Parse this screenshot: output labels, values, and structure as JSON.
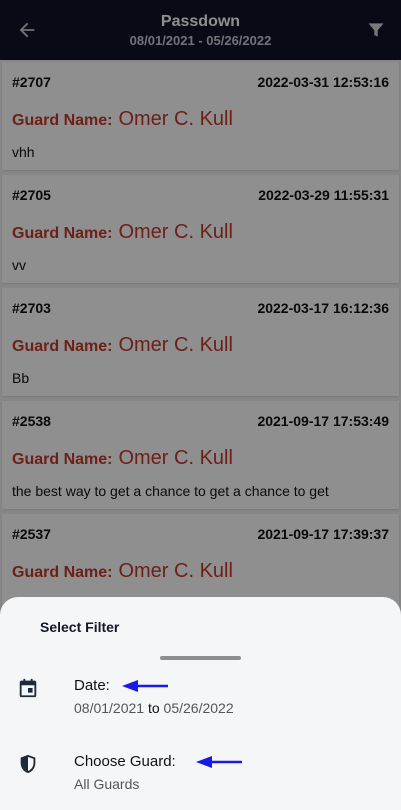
{
  "header": {
    "title": "Passdown",
    "date_range": "08/01/2021 - 05/26/2022"
  },
  "entries": [
    {
      "id": "#2707",
      "datetime": "2022-03-31 12:53:16",
      "guard_label": "Guard Name:",
      "guard_name": "Omer C. Kull",
      "note": "vhh"
    },
    {
      "id": "#2705",
      "datetime": "2022-03-29 11:55:31",
      "guard_label": "Guard Name:",
      "guard_name": "Omer C. Kull",
      "note": "vv"
    },
    {
      "id": "#2703",
      "datetime": "2022-03-17 16:12:36",
      "guard_label": "Guard Name:",
      "guard_name": "Omer C. Kull",
      "note": "Bb"
    },
    {
      "id": "#2538",
      "datetime": "2021-09-17 17:53:49",
      "guard_label": "Guard Name:",
      "guard_name": "Omer C. Kull",
      "note": "the best way to get a chance to get a chance to get"
    },
    {
      "id": "#2537",
      "datetime": "2021-09-17 17:39:37",
      "guard_label": "Guard Name:",
      "guard_name": "Omer C. Kull",
      "note": ""
    }
  ],
  "sheet": {
    "title": "Select Filter",
    "date": {
      "label": "Date:",
      "from": "08/01/2021",
      "to_word": "to",
      "to": "05/26/2022"
    },
    "guard": {
      "label": "Choose Guard:",
      "value": "All Guards"
    }
  },
  "icons": {
    "back": "arrow-left-icon",
    "filter": "filter-icon",
    "date": "calendar-icon",
    "guard": "shield-icon",
    "annotation": "arrow-pointer-icon"
  },
  "colors": {
    "topbar": "#0f1526",
    "guard_text": "#c0392b",
    "annotation_arrow": "#1a1ae6"
  }
}
